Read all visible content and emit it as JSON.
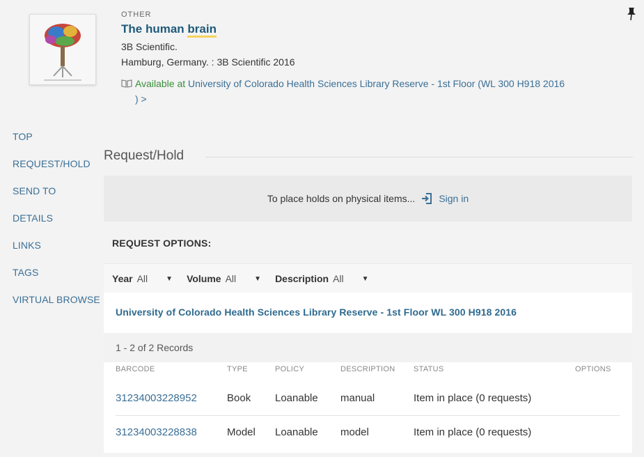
{
  "record": {
    "type": "OTHER",
    "title_part1": "The human ",
    "title_part2": "brain",
    "publisher": "3B Scientific.",
    "imprint": "Hamburg, Germany. : 3B Scientific 2016",
    "availability_status": "Available at ",
    "availability_location": "University of Colorado Health Sciences Library  Reserve - 1st Floor (WL 300 H918 2016",
    "availability_tail": ") >",
    "thumbnail_icon": "brain-model-image",
    "pin_icon": "pin-icon"
  },
  "nav": {
    "items": [
      "TOP",
      "REQUEST/HOLD",
      "SEND TO",
      "DETAILS",
      "LINKS",
      "TAGS",
      "VIRTUAL BROWSE"
    ]
  },
  "request": {
    "section_title": "Request/Hold",
    "signin_prompt": "To place holds on physical items...",
    "signin_label": "Sign in",
    "options_label": "REQUEST OPTIONS:"
  },
  "filters": {
    "year_label": "Year",
    "year_value": "All",
    "volume_label": "Volume",
    "volume_value": "All",
    "description_label": "Description",
    "description_value": "All"
  },
  "holdings": {
    "location": "University of Colorado Health Sciences Library  Reserve - 1st Floor  WL 300 H918 2016",
    "records_count": "1 - 2 of 2 Records",
    "columns": [
      "BARCODE",
      "TYPE",
      "POLICY",
      "DESCRIPTION",
      "STATUS",
      "OPTIONS"
    ],
    "rows": [
      {
        "barcode": "31234003228952",
        "type": "Book",
        "policy": "Loanable",
        "description": "manual",
        "status": "Item in place (0 requests)"
      },
      {
        "barcode": "31234003228838",
        "type": "Model",
        "policy": "Loanable",
        "description": "model",
        "status": "Item in place (0 requests)"
      }
    ]
  },
  "colors": {
    "link": "#3a6f96",
    "available": "#3a8e3a",
    "highlight": "#f6d35b"
  }
}
